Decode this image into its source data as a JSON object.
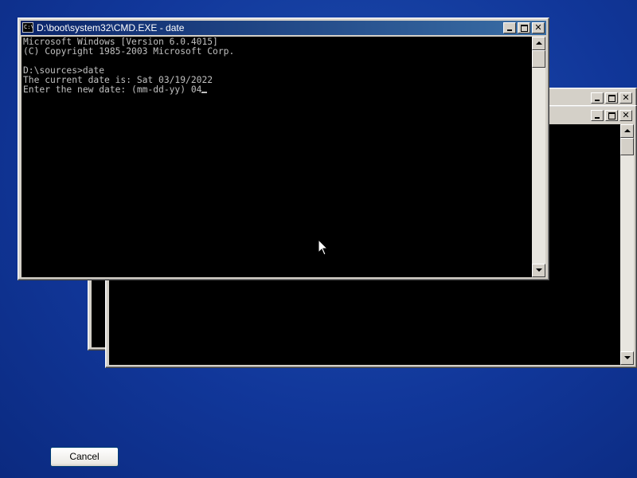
{
  "windows": {
    "main": {
      "title": "D:\\boot\\system32\\CMD.EXE - date",
      "icon_text": "C:\\",
      "console_lines": [
        "Microsoft Windows [Version 6.0.4015]",
        "(C) Copyright 1985-2003 Microsoft Corp.",
        "",
        "D:\\sources>date",
        "The current date is: Sat 03/19/2022",
        "Enter the new date: (mm-dd-yy) 04"
      ],
      "close_glyph": "✕"
    },
    "background": {
      "close_glyph": "✕"
    }
  },
  "cancel_button": {
    "label": "Cancel"
  },
  "colors": {
    "desktop": "#11379a",
    "console_bg": "#000000",
    "console_text": "#c0c0c0",
    "title_active": "#0a246a"
  },
  "icons": {
    "cursor": "mouse-pointer-icon",
    "window": "command-prompt-icon"
  }
}
